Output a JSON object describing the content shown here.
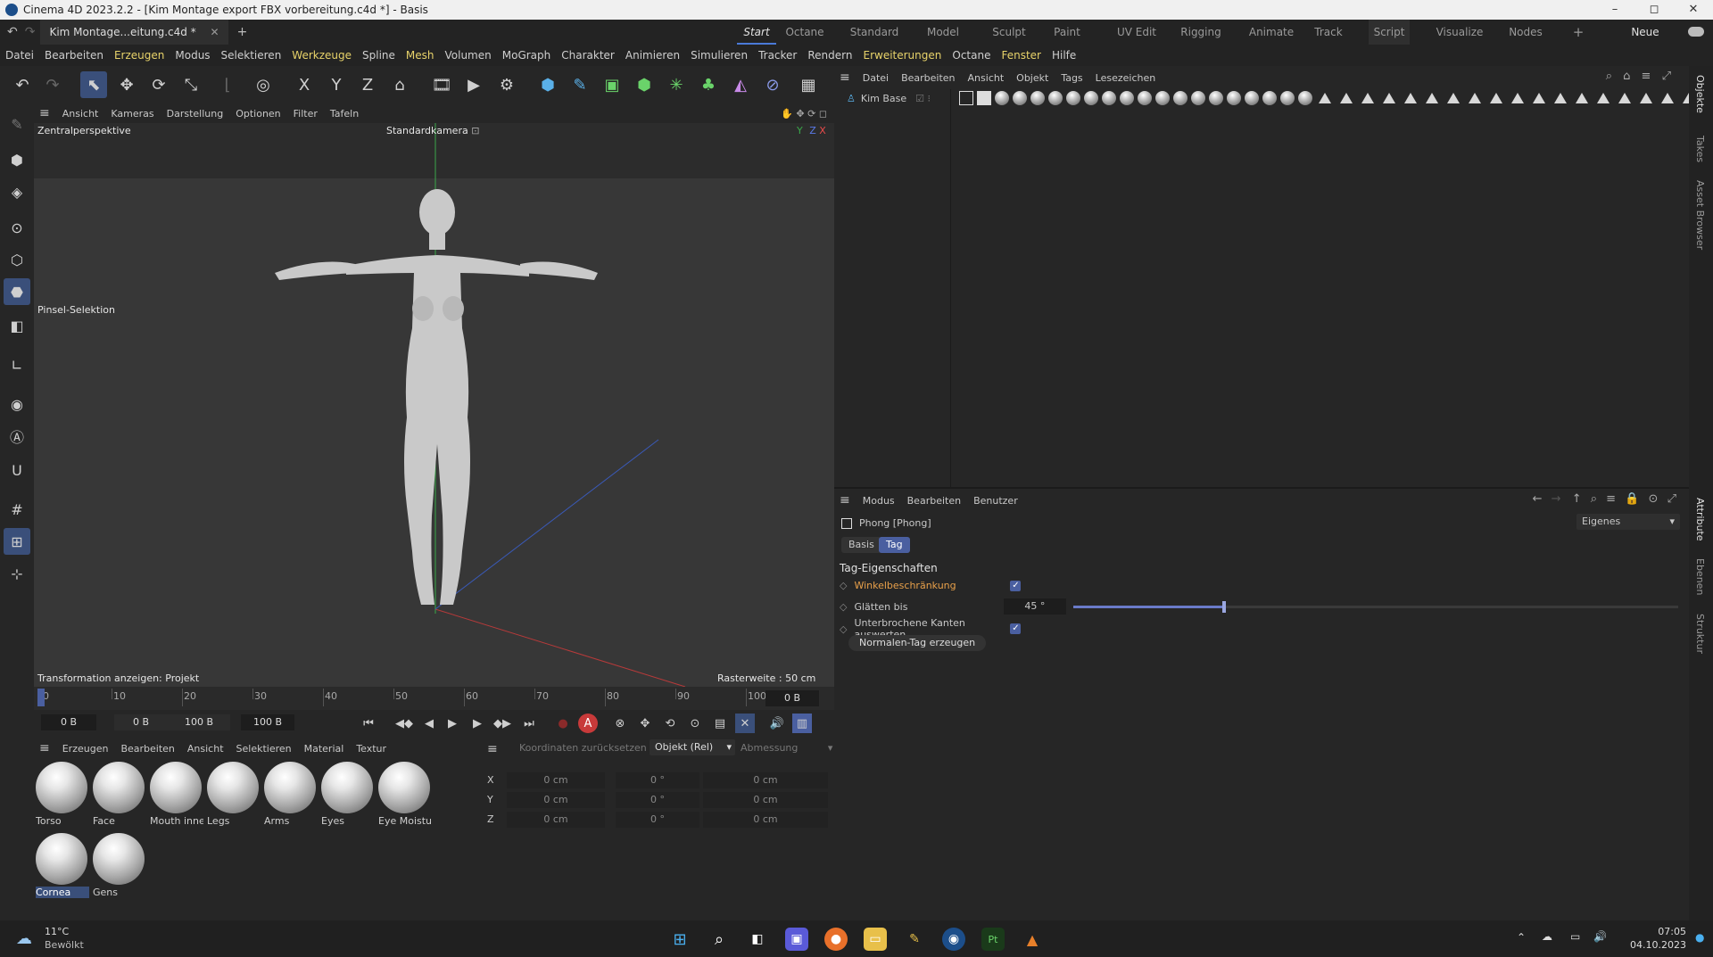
{
  "window": {
    "title": "Cinema 4D 2023.2.2 - [Kim Montage export FBX vorbereitung.c4d *] - Basis",
    "controls": [
      "–",
      "◻",
      "✕"
    ]
  },
  "doc_tab": {
    "label": "Kim Montage...eitung.c4d *",
    "close": "✕",
    "add": "+"
  },
  "layouts": {
    "tabs": [
      "Start",
      "Octane",
      "Standard",
      "Model",
      "Sculpt",
      "Paint",
      "UV Edit",
      "Rigging",
      "Animate",
      "Track",
      "Script",
      "Visualize",
      "Nodes"
    ],
    "active": "Start",
    "add": "+",
    "new_layouts": "Neue Layouts"
  },
  "menu": [
    "Datei",
    "Bearbeiten",
    "Erzeugen",
    "Modus",
    "Selektieren",
    "Werkzeuge",
    "Spline",
    "Mesh",
    "Volumen",
    "MoGraph",
    "Charakter",
    "Animieren",
    "Simulieren",
    "Tracker",
    "Rendern",
    "Erweiterungen",
    "Octane",
    "Fenster",
    "Hilfe"
  ],
  "viewport_menu": [
    "Ansicht",
    "Kameras",
    "Darstellung",
    "Optionen",
    "Filter",
    "Tafeln"
  ],
  "viewport": {
    "projection": "Zentralperspektive",
    "camera": "Standardkamera",
    "camera_icon": "⊡",
    "brush_label": "Pinsel-Selektion",
    "transform_label": "Transformation anzeigen: Projekt",
    "grid_label": "Rasterweite : 50 cm",
    "axis_y": "Y",
    "axis_z": "Z",
    "axis_x": "X"
  },
  "timeline": {
    "ticks": [
      "0",
      "10",
      "20",
      "30",
      "40",
      "50",
      "60",
      "70",
      "80",
      "90",
      "100"
    ],
    "current_frame": "0 B",
    "current_tick": 0,
    "max_tick": 100
  },
  "playback": {
    "start": "0 B",
    "range_start": "0 B",
    "range_end": "100 B",
    "end": "100 B"
  },
  "material_menu": [
    "Erzeugen",
    "Bearbeiten",
    "Ansicht",
    "Selektieren",
    "Material",
    "Textur"
  ],
  "materials": [
    {
      "name": "Torso"
    },
    {
      "name": "Face"
    },
    {
      "name": "Mouth inne"
    },
    {
      "name": "Legs"
    },
    {
      "name": "Arms"
    },
    {
      "name": "Eyes"
    },
    {
      "name": "Eye Moistur"
    },
    {
      "name": "Cornea"
    },
    {
      "name": "Gens"
    }
  ],
  "selected_material": "Cornea",
  "coords": {
    "reset_label": "Koordinaten zurücksetzen",
    "mode": "Objekt (Rel)",
    "size_mode": "Abmessung",
    "rows": [
      {
        "axis": "X",
        "pos": "0 cm",
        "rot": "0 °",
        "size": "0 cm"
      },
      {
        "axis": "Y",
        "pos": "0 cm",
        "rot": "0 °",
        "size": "0 cm"
      },
      {
        "axis": "Z",
        "pos": "0 cm",
        "rot": "0 °",
        "size": "0 cm"
      }
    ]
  },
  "object_menu": [
    "Datei",
    "Bearbeiten",
    "Ansicht",
    "Objekt",
    "Tags",
    "Lesezeichen"
  ],
  "object": {
    "name": "Kim Base"
  },
  "attr_menu": [
    "Modus",
    "Bearbeiten",
    "Benutzer"
  ],
  "attributes": {
    "header": "Phong [Phong]",
    "preset": "Eigenes",
    "tabs": [
      "Basis",
      "Tag"
    ],
    "active_tab": "Tag",
    "section": "Tag-Eigenschaften",
    "props": [
      {
        "label": "Winkelbeschränkung",
        "checked": true,
        "highlight": true
      },
      {
        "label": "Glätten bis",
        "value": "45 °",
        "slider_fraction": 0.25
      },
      {
        "label": "Unterbrochene Kanten auswerten",
        "checked": true
      }
    ],
    "button": "Normalen-Tag erzeugen"
  },
  "right_tabs": [
    "Objekte",
    "Takes",
    "Asset Browser",
    "Attribute",
    "Ebenen",
    "Struktur"
  ],
  "taskbar": {
    "weather_temp": "11°C",
    "weather_desc": "Bewölkt",
    "time": "07:05",
    "date": "04.10.2023"
  },
  "colors": {
    "accent_blue": "#4a5fa0",
    "highlight_orange": "#e8a04a",
    "menu_highlight": "#e8d36a"
  }
}
